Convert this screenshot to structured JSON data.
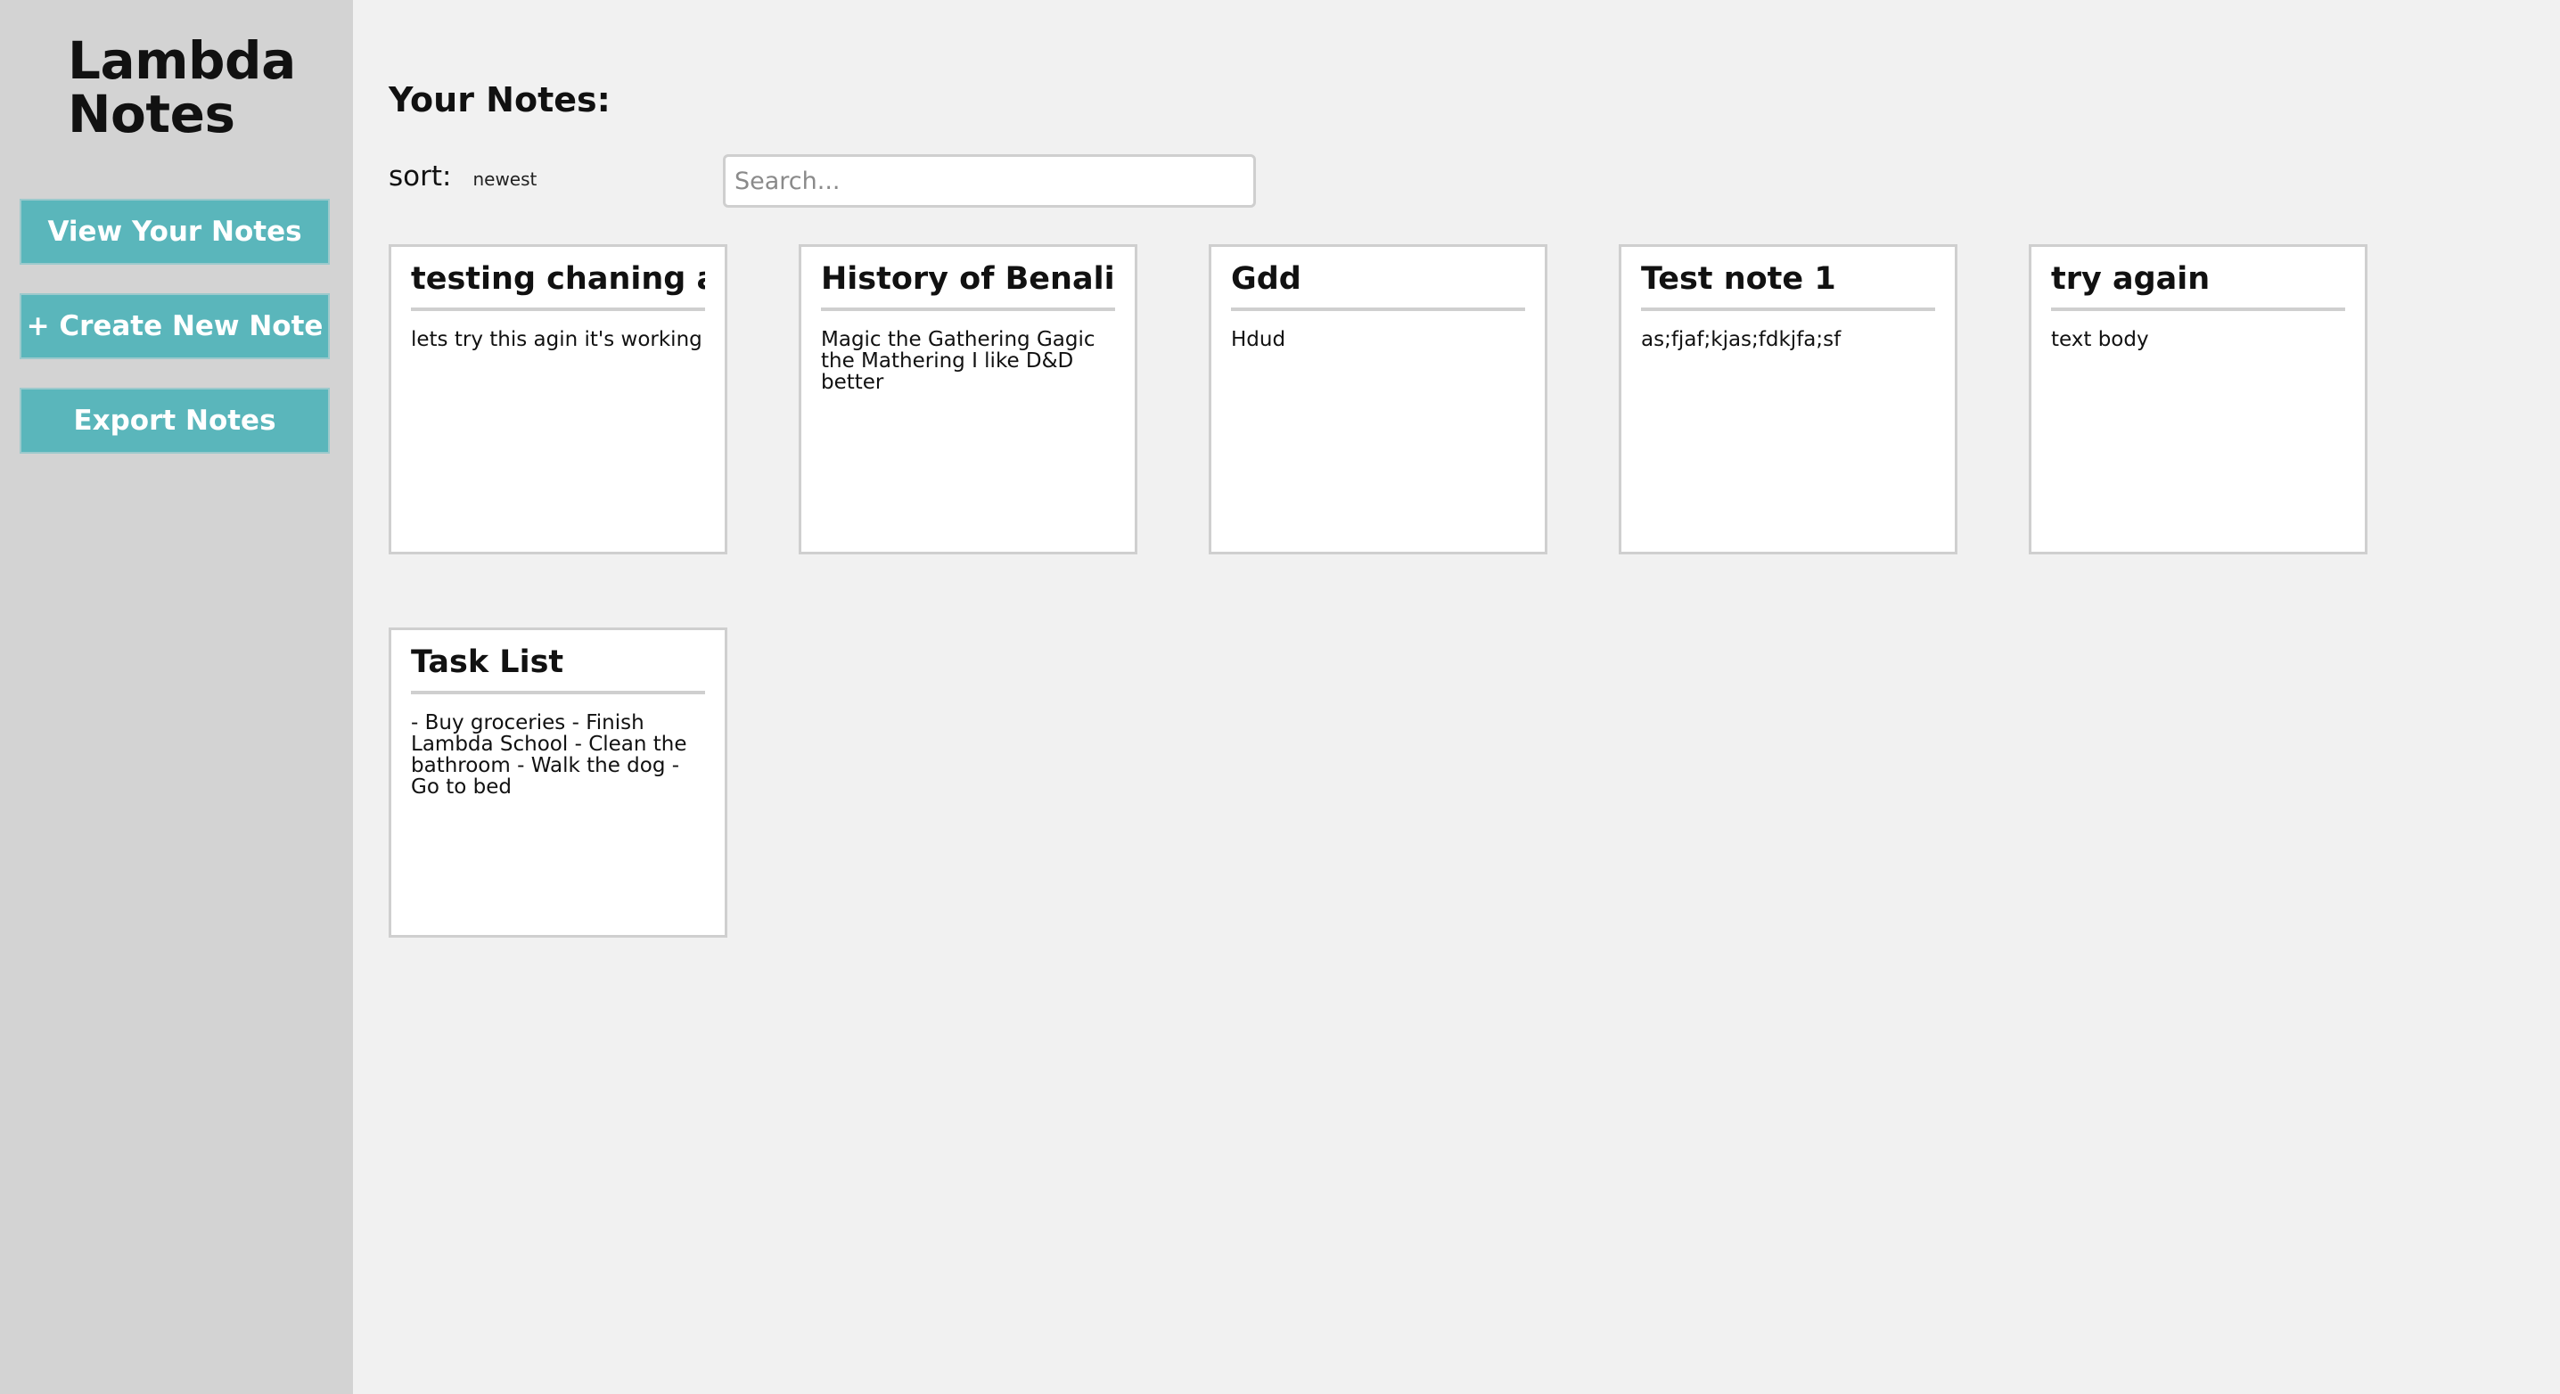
{
  "sidebar": {
    "app_title": "Lambda Notes",
    "buttons": {
      "view": "View Your Notes",
      "create": "+ Create New Note",
      "export": "Export Notes"
    }
  },
  "main": {
    "title": "Your Notes:",
    "sort_label": "sort:",
    "sort_value": "newest",
    "search_placeholder": "Search...",
    "notes": [
      {
        "title": "testing chaning again",
        "body": "lets try this agin it's working"
      },
      {
        "title": "History of Benalia",
        "body": "Magic the Gathering Gagic the Mathering I like D&D better"
      },
      {
        "title": "Gdd",
        "body": "Hdud"
      },
      {
        "title": "Test note 1",
        "body": "as;fjaf;kjas;fdkjfa;sf"
      },
      {
        "title": "try again",
        "body": "text body"
      },
      {
        "title": "Task List",
        "body": "- Buy groceries - Finish Lambda School - Clean the bathroom - Walk the dog - Go to bed"
      }
    ]
  },
  "colors": {
    "sidebar_bg": "#d3d3d3",
    "main_bg": "#f1f1f1",
    "accent": "#5ab6bb",
    "card_border": "#cfcfcf"
  }
}
